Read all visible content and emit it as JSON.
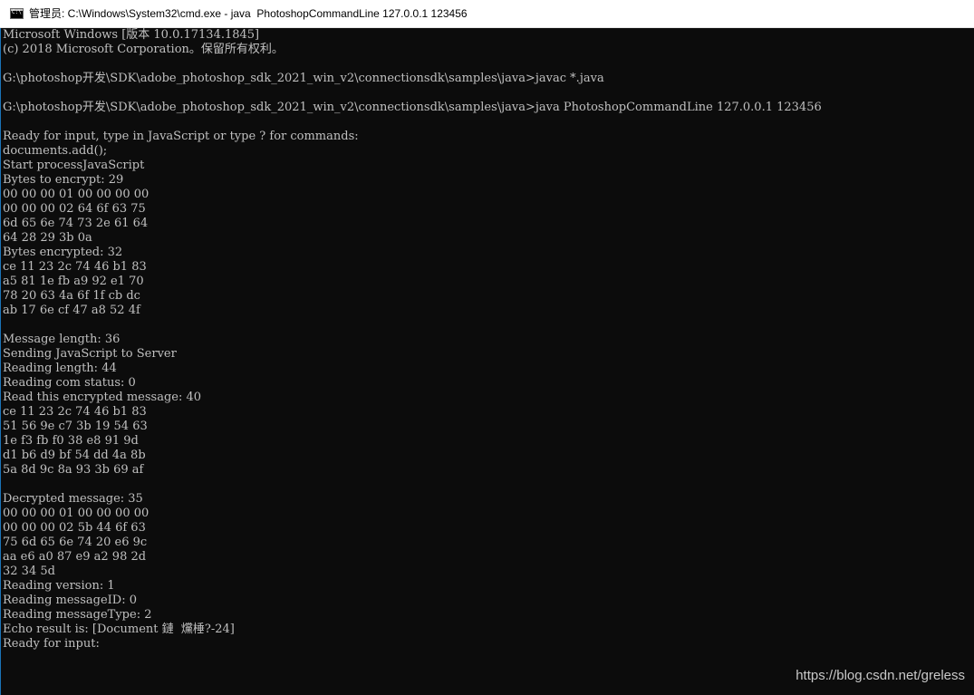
{
  "window": {
    "title": "管理员: C:\\Windows\\System32\\cmd.exe - java  PhotoshopCommandLine 127.0.0.1 123456",
    "icon": "cmd-console-icon",
    "icon_glyph": "C:\\"
  },
  "colors": {
    "console_background": "#0c0c0c",
    "console_text": "#c0c0c0",
    "titlebar_background": "#ffffff"
  },
  "console": {
    "lines": [
      "Microsoft Windows [版本 10.0.17134.1845]",
      "(c) 2018 Microsoft Corporation。保留所有权利。",
      "",
      "G:\\photoshop开发\\SDK\\adobe_photoshop_sdk_2021_win_v2\\connectionsdk\\samples\\java>javac *.java",
      "",
      "G:\\photoshop开发\\SDK\\adobe_photoshop_sdk_2021_win_v2\\connectionsdk\\samples\\java>java PhotoshopCommandLine 127.0.0.1 123456",
      "",
      "Ready for input, type in JavaScript or type ? for commands:",
      "documents.add();",
      "Start processJavaScript",
      "Bytes to encrypt: 29",
      "00 00 00 01 00 00 00 00",
      "00 00 00 02 64 6f 63 75",
      "6d 65 6e 74 73 2e 61 64",
      "64 28 29 3b 0a",
      "Bytes encrypted: 32",
      "ce 11 23 2c 74 46 b1 83",
      "a5 81 1e fb a9 92 e1 70",
      "78 20 63 4a 6f 1f cb dc",
      "ab 17 6e cf 47 a8 52 4f",
      "",
      "Message length: 36",
      "Sending JavaScript to Server",
      "Reading length: 44",
      "Reading com status: 0",
      "Read this encrypted message: 40",
      "ce 11 23 2c 74 46 b1 83",
      "51 56 9e c7 3b 19 54 63",
      "1e f3 fb f0 38 e8 91 9d",
      "d1 b6 d9 bf 54 dd 4a 8b",
      "5a 8d 9c 8a 93 3b 69 af",
      "",
      "Decrypted message: 35",
      "00 00 00 01 00 00 00 00",
      "00 00 00 02 5b 44 6f 63",
      "75 6d 65 6e 74 20 e6 9c",
      "aa e6 a0 87 e9 a2 98 2d",
      "32 34 5d",
      "Reading version: 1",
      "Reading messageID: 0",
      "Reading messageType: 2",
      "Echo result is: [Document 鏈  爣棰?-24]",
      "Ready for input:"
    ]
  },
  "watermark": {
    "text": "https://blog.csdn.net/greless"
  }
}
